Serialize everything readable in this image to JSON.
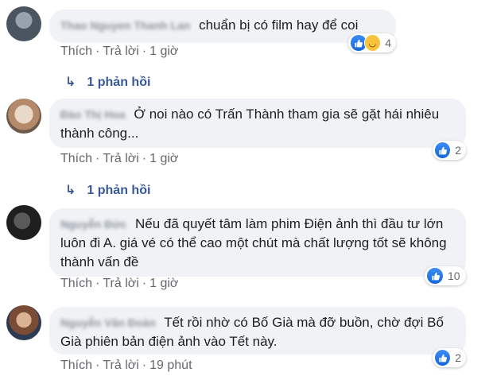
{
  "comments": [
    {
      "author": "Thao Nguyen Thanh Lan",
      "text": "chuẩn bị có film hay để coi",
      "actions": {
        "like": "Thích",
        "reply": "Trả lời",
        "time": "1 giờ"
      },
      "reactions": {
        "types": [
          "like-icon",
          "haha-icon"
        ],
        "count": "4"
      },
      "replies_label": "1 phản hồi"
    },
    {
      "author": "Đào Thị Hoa",
      "text": "Ở noi nào có Trấn Thành tham gia sẽ gặt hái nhiêu thành công...",
      "actions": {
        "like": "Thích",
        "reply": "Trả lời",
        "time": "1 giờ"
      },
      "reactions": {
        "types": [
          "like-icon"
        ],
        "count": "2"
      },
      "replies_label": "1 phản hồi"
    },
    {
      "author": "Nguyễn Đức",
      "text": "Nếu đã quyết tâm làm phim Điện ảnh thì đầu tư lớn luôn đi A. giá vé có thể cao một chút mà chất lượng tốt sẽ không thành vấn đề",
      "actions": {
        "like": "Thích",
        "reply": "Trả lời",
        "time": "1 giờ"
      },
      "reactions": {
        "types": [
          "like-icon"
        ],
        "count": "10"
      }
    },
    {
      "author": "Nguyễn Văn Đoàn",
      "text": "Tết rồi nhờ có Bố Già mà đỡ buồn, chờ đợi Bố Già phiên bản điện ảnh vào Tết này.",
      "actions": {
        "like": "Thích",
        "reply": "Trả lời",
        "time": "19 phút"
      },
      "reactions": {
        "types": [
          "like-icon"
        ],
        "count": "2"
      }
    }
  ],
  "colors": {
    "link": "#385898",
    "bubble": "#f0f2f5",
    "like": "#1877f2"
  }
}
